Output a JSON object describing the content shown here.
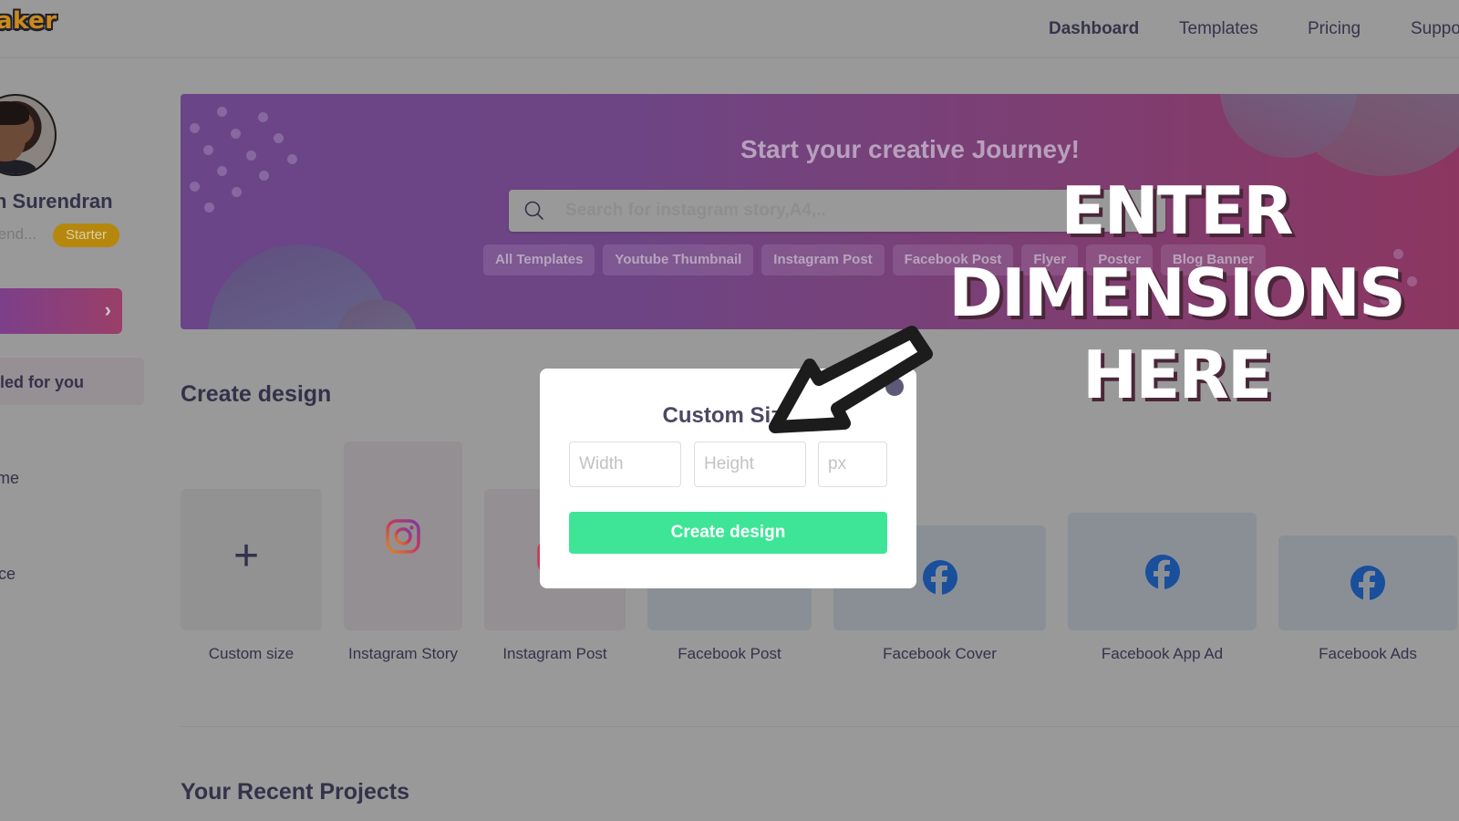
{
  "header": {
    "logo_text": "aker",
    "nav": [
      {
        "label": "Dashboard",
        "active": true
      },
      {
        "label": "Templates",
        "active": false
      },
      {
        "label": "Pricing",
        "active": false
      },
      {
        "label": "Suppo",
        "active": false
      }
    ]
  },
  "sidebar": {
    "user_name": "h Surendran",
    "user_email": "rend...",
    "plan_badge": "Starter",
    "upgrade_chevron": "›",
    "items": [
      {
        "label": "led for you",
        "active": true
      },
      {
        "label": "me",
        "active": false
      },
      {
        "label": "ce",
        "active": false
      }
    ]
  },
  "banner": {
    "title": "Start your creative Journey!",
    "search_placeholder": "Search for instagram story,A4,..",
    "chips": [
      "All Templates",
      "Youtube Thumbnail",
      "Instagram Post",
      "Facebook Post",
      "Flyer",
      "Poster",
      "Blog Banner"
    ]
  },
  "create_design": {
    "title": "Create design",
    "cards": [
      {
        "label": "Custom size",
        "icon": "plus-icon"
      },
      {
        "label": "Instagram Story",
        "icon": "instagram-icon"
      },
      {
        "label": "Instagram Post",
        "icon": "instagram-icon"
      },
      {
        "label": "Facebook Post",
        "icon": "facebook-icon"
      },
      {
        "label": "Facebook Cover",
        "icon": "facebook-icon"
      },
      {
        "label": "Facebook App Ad",
        "icon": "facebook-icon"
      },
      {
        "label": "Facebook Ads",
        "icon": "facebook-icon"
      }
    ]
  },
  "recent": {
    "title": "Your Recent Projects"
  },
  "modal": {
    "title": "Custom Size",
    "width_placeholder": "Width",
    "height_placeholder": "Height",
    "unit_placeholder": "px",
    "create_label": "Create design",
    "accent": "#3ee596"
  },
  "annotation": {
    "lines": [
      "ENTER",
      "DIMENSIONS",
      "HERE"
    ]
  }
}
